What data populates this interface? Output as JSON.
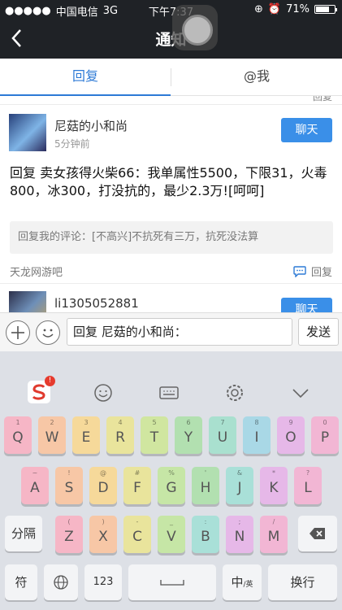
{
  "status": {
    "carrier": "中国电信",
    "network": "3G",
    "time": "下午7:37",
    "battery": "71%",
    "battery_level": 0.71
  },
  "nav": {
    "title": "通知"
  },
  "tabs": [
    {
      "label": "回复"
    },
    {
      "label": "@我"
    }
  ],
  "partial_top": {
    "reply_label": "回复"
  },
  "posts": [
    {
      "author": "尼菇的小和尚",
      "time": "5分钟前",
      "chat_label": "聊天",
      "content": "回复 卖女孩得火柴66：我单属性5500，下限31，火毒800，冰300，打没抗的，最少2.3万![呵呵]",
      "quote": "回复我的评论：[不高兴]不抗死有三万，抗死没法算",
      "forum": "天龙网游吧",
      "reply_label": "回复"
    },
    {
      "author": "li1305052881",
      "chat_label": "聊天"
    }
  ],
  "reply_bar": {
    "input_value": "回复 尼菇的小和尚：",
    "send_label": "发送"
  },
  "keyboard": {
    "row1": [
      {
        "key": "Q",
        "hint": "1",
        "color": "#f6b6c6"
      },
      {
        "key": "W",
        "hint": "2",
        "color": "#f7c7a6"
      },
      {
        "key": "E",
        "hint": "3",
        "color": "#f6d99a"
      },
      {
        "key": "R",
        "hint": "4",
        "color": "#e9e49c"
      },
      {
        "key": "T",
        "hint": "5",
        "color": "#d0e6a0"
      },
      {
        "key": "Y",
        "hint": "6",
        "color": "#b2e0b0"
      },
      {
        "key": "U",
        "hint": "7",
        "color": "#a9e0cf"
      },
      {
        "key": "I",
        "hint": "8",
        "color": "#a9d8e6"
      },
      {
        "key": "O",
        "hint": "9",
        "color": "#e6b8e8"
      },
      {
        "key": "P",
        "hint": "0",
        "color": "#f2b6d4"
      }
    ],
    "row2": [
      {
        "key": "A",
        "hint": "~",
        "color": "#f6b6c6"
      },
      {
        "key": "S",
        "hint": "!",
        "color": "#f7c7a6"
      },
      {
        "key": "D",
        "hint": "@",
        "color": "#f6d99a"
      },
      {
        "key": "F",
        "hint": "#",
        "color": "#e9e49c"
      },
      {
        "key": "G",
        "hint": "%",
        "color": "#c6e6a6"
      },
      {
        "key": "H",
        "hint": "'",
        "color": "#b2e0b0"
      },
      {
        "key": "J",
        "hint": "&",
        "color": "#a9e0d8"
      },
      {
        "key": "K",
        "hint": "*",
        "color": "#e6b8e8"
      },
      {
        "key": "L",
        "hint": "?",
        "color": "#f2b6d4"
      }
    ],
    "row3": [
      {
        "key": "Z",
        "hint": "(",
        "color": "#f6b6c6"
      },
      {
        "key": "X",
        "hint": ")",
        "color": "#f7c7a6"
      },
      {
        "key": "C",
        "hint": "-",
        "color": "#e9e49c"
      },
      {
        "key": "V",
        "hint": "_",
        "color": "#c6e6a6"
      },
      {
        "key": "B",
        "hint": ":",
        "color": "#a9e0d8"
      },
      {
        "key": "N",
        "hint": ";",
        "color": "#e6b8e8"
      },
      {
        "key": "M",
        "hint": "/",
        "color": "#f2b6d4"
      }
    ],
    "fenge": "分隔",
    "fu": "符",
    "num": "123",
    "zhong": "中",
    "zhong_sub": "/英",
    "enter": "换行"
  },
  "colors": {
    "accent": "#3a8fe8",
    "topbar": "#1f2226"
  }
}
